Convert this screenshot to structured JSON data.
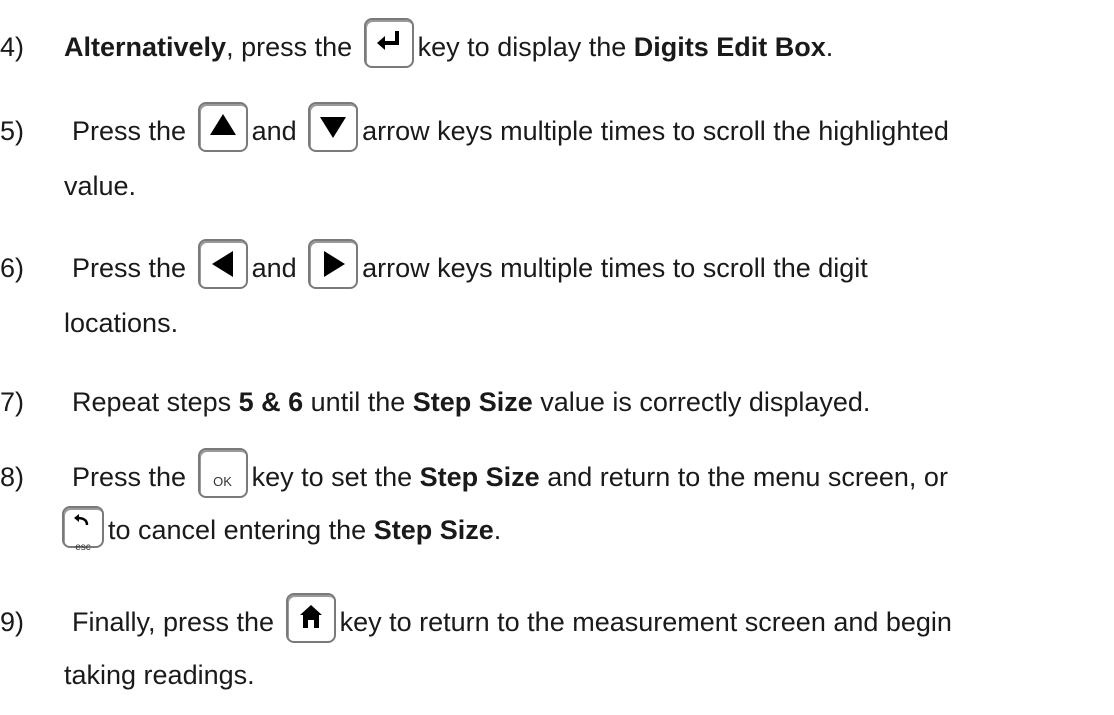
{
  "steps": [
    {
      "number": "4)",
      "parts": [
        "",
        "Alternatively",
        ", press the ",
        "key to display the ",
        "Digits Edit Box",
        "."
      ]
    },
    {
      "number": "5)",
      "line1": [
        "Press the ",
        "and ",
        "arrow keys multiple times to scroll the highlighted"
      ],
      "line2": "value."
    },
    {
      "number": "6)",
      "line1": [
        "Press the ",
        "and ",
        "arrow keys multiple times to scroll the digit"
      ],
      "line2": "locations."
    },
    {
      "number": "7)",
      "parts": [
        "Repeat steps ",
        "5 & 6",
        " until the ",
        "Step Size",
        " value is correctly displayed."
      ]
    },
    {
      "number": "8)",
      "line1": [
        "Press the ",
        "key to set the ",
        "Step Size",
        " and return to the menu screen, or"
      ],
      "line2": [
        "to cancel entering the ",
        "Step Size",
        "."
      ]
    },
    {
      "number": "9)",
      "line1": [
        "Finally, press the ",
        "key to return to the measurement screen and begin"
      ],
      "line2": "taking readings."
    }
  ],
  "keys": {
    "enter": "enter-icon",
    "up": "up-arrow-icon",
    "down": "down-arrow-icon",
    "left": "left-arrow-icon",
    "right": "right-arrow-icon",
    "ok_label": "OK",
    "esc_label": "esc",
    "home": "home-icon"
  }
}
